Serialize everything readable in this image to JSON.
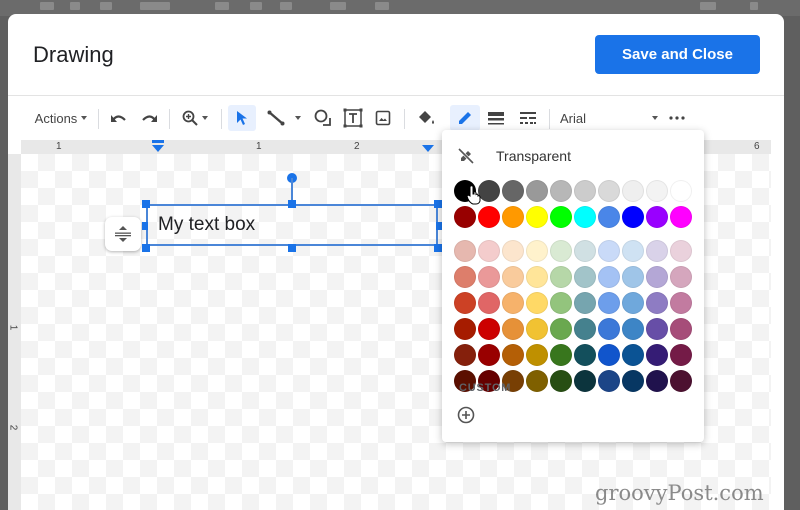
{
  "dialog": {
    "title": "Drawing",
    "save_label": "Save and Close"
  },
  "toolbar": {
    "actions_label": "Actions",
    "font_label": "Arial",
    "icons": [
      "undo-icon",
      "redo-icon",
      "zoom-icon",
      "select-icon",
      "line-icon",
      "shape-icon",
      "textbox-icon",
      "image-icon",
      "fill-color-icon",
      "border-color-icon",
      "border-weight-icon",
      "border-dash-icon",
      "more-icon"
    ]
  },
  "ruler": {
    "horizontal_labels": [
      "1",
      "1",
      "2",
      "6"
    ],
    "vertical_labels": [
      "1",
      "2"
    ]
  },
  "canvas": {
    "textbox_text": "My text box"
  },
  "color_menu": {
    "transparent_label": "Transparent",
    "custom_label": "CUSTOM",
    "selected_color": "#000000",
    "rows": [
      [
        "#000000",
        "#434343",
        "#666666",
        "#999999",
        "#b7b7b7",
        "#cccccc",
        "#d9d9d9",
        "#efefef",
        "#f3f3f3",
        "#ffffff"
      ],
      [
        "#980000",
        "#ff0000",
        "#ff9900",
        "#ffff00",
        "#00ff00",
        "#00ffff",
        "#4a86e8",
        "#0000ff",
        "#9900ff",
        "#ff00ff"
      ],
      [
        "#e6b8af",
        "#f4cccc",
        "#fce5cd",
        "#fff2cc",
        "#d9ead3",
        "#d0e0e3",
        "#c9daf8",
        "#cfe2f3",
        "#d9d2e9",
        "#ead1dc"
      ],
      [
        "#dd7e6b",
        "#ea9999",
        "#f9cb9c",
        "#ffe599",
        "#b6d7a8",
        "#a2c4c9",
        "#a4c2f4",
        "#9fc5e8",
        "#b4a7d6",
        "#d5a6bd"
      ],
      [
        "#cc4125",
        "#e06666",
        "#f6b26b",
        "#ffd966",
        "#93c47d",
        "#76a5af",
        "#6d9eeb",
        "#6fa8dc",
        "#8e7cc3",
        "#c27ba0"
      ],
      [
        "#a61c00",
        "#cc0000",
        "#e69138",
        "#f1c232",
        "#6aa84f",
        "#45818e",
        "#3c78d8",
        "#3d85c6",
        "#674ea7",
        "#a64d79"
      ],
      [
        "#85200c",
        "#990000",
        "#b45f06",
        "#bf9000",
        "#38761d",
        "#134f5c",
        "#1155cc",
        "#0b5394",
        "#351c75",
        "#741b47"
      ],
      [
        "#5b0f00",
        "#660000",
        "#783f04",
        "#7f6000",
        "#274e13",
        "#0c343d",
        "#1c4587",
        "#073763",
        "#20124d",
        "#4c1130"
      ]
    ]
  },
  "watermark": "groovyPost.com"
}
